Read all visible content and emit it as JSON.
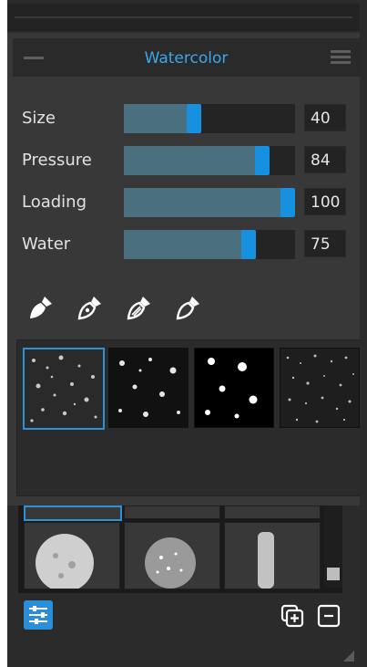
{
  "panel": {
    "title": "Watercolor",
    "accent_color": "#3ba7ea",
    "slider_fill_color": "#4a7080",
    "slider_thumb_color": "#1890e0"
  },
  "sliders": [
    {
      "label": "Size",
      "value": "40",
      "level": 40
    },
    {
      "label": "Pressure",
      "value": "84",
      "level": 84
    },
    {
      "label": "Loading",
      "value": "100",
      "level": 100
    },
    {
      "label": "Water",
      "value": "75",
      "level": 75
    }
  ],
  "tool_icons": [
    "brush-tip-filled-icon",
    "brush-tip-outline-icon",
    "brush-tip-lined-icon",
    "brush-tip-hollow-icon"
  ],
  "brush_textures": {
    "selected_index": 0,
    "items": [
      "texture-1",
      "texture-2",
      "texture-3",
      "texture-4"
    ]
  },
  "brush_presets": {
    "selected_index": 0
  },
  "footer": {
    "settings_icon": "sliders-icon",
    "add_icon": "add-copy-icon",
    "remove_icon": "remove-icon"
  }
}
